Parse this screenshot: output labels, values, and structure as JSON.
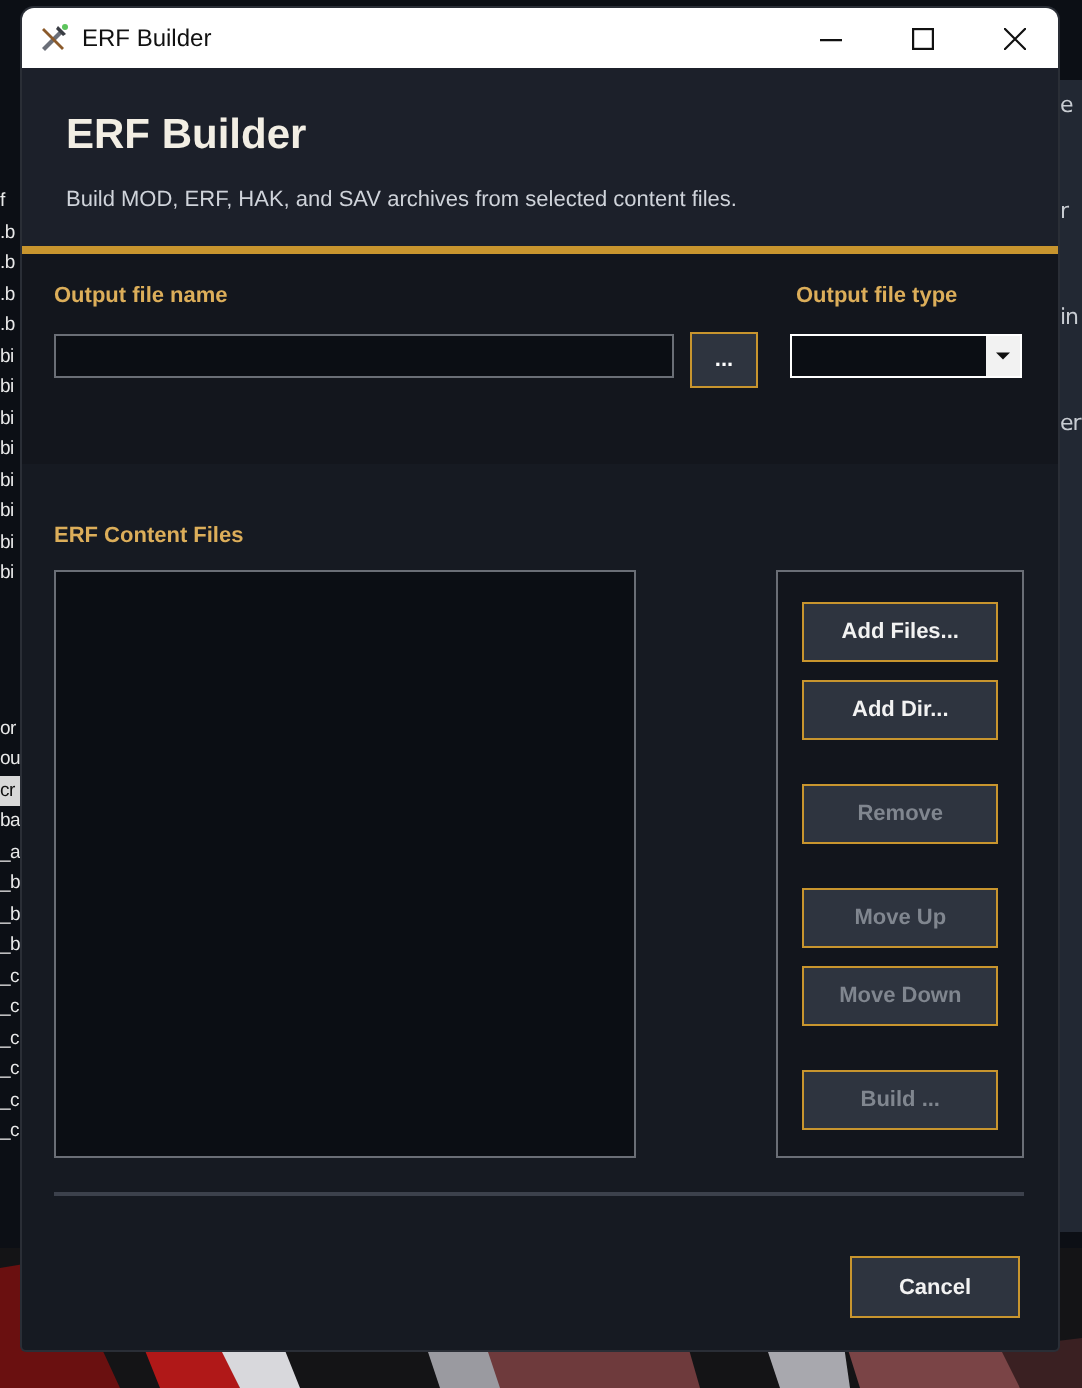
{
  "background_app": {
    "left_fragments_top": [
      "f",
      ".b",
      ".b",
      ".b",
      ".b",
      "bi",
      "bi",
      "bi",
      "bi",
      "bi",
      "bi",
      "bi",
      "bi"
    ],
    "left_fragments_bottom": [
      {
        "text": "or",
        "selected": false
      },
      {
        "text": "ou",
        "selected": false
      },
      {
        "text": "cr",
        "selected": true
      },
      {
        "text": "ba",
        "selected": false
      },
      {
        "text": "_a",
        "selected": false
      },
      {
        "text": "_b",
        "selected": false
      },
      {
        "text": "_b",
        "selected": false
      },
      {
        "text": "_b",
        "selected": false
      },
      {
        "text": "_c",
        "selected": false
      },
      {
        "text": "_c",
        "selected": false
      },
      {
        "text": "_c",
        "selected": false
      },
      {
        "text": "_c",
        "selected": false
      },
      {
        "text": "_c",
        "selected": false
      },
      {
        "text": "_c",
        "selected": false
      }
    ],
    "right_fragments": [
      "e",
      "r",
      "in",
      "er"
    ]
  },
  "window": {
    "title": "ERF Builder"
  },
  "header": {
    "title": "ERF Builder",
    "subtitle": "Build MOD, ERF, HAK, and SAV archives from selected content files."
  },
  "output_name": {
    "label": "Output file name",
    "browse": "..."
  },
  "output_type": {
    "label": "Output file type"
  },
  "content": {
    "label": "ERF Content Files",
    "button_groups": [
      {
        "buttons": [
          {
            "label": "Add Files...",
            "disabled": false
          },
          {
            "label": "Add Dir...",
            "disabled": false
          }
        ]
      },
      {
        "buttons": [
          {
            "label": "Remove",
            "disabled": true
          }
        ]
      },
      {
        "buttons": [
          {
            "label": "Move Up",
            "disabled": true
          },
          {
            "label": "Move Down",
            "disabled": true
          }
        ]
      },
      {
        "buttons": [
          {
            "label": "Build ...",
            "disabled": true
          }
        ]
      }
    ]
  },
  "footer": {
    "cancel": "Cancel"
  }
}
